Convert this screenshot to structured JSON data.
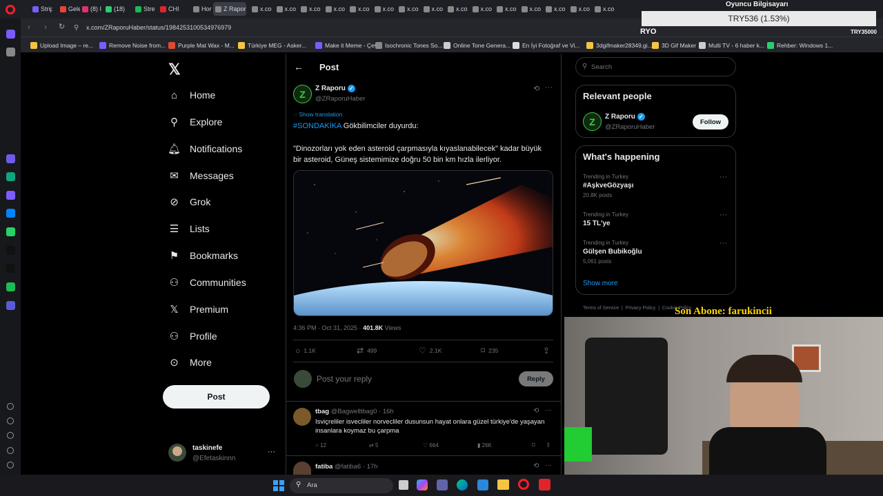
{
  "browser": {
    "tabs": [
      "Strip",
      "Gele",
      "(8) I",
      "(18)",
      "Stre",
      "CHI",
      "Hor",
      "Z Rapor",
      "x.co",
      "x.co",
      "x.co",
      "x.co",
      "x.co",
      "x.co",
      "x.co",
      "x.co",
      "x.co",
      "x.co",
      "x.co",
      "x.co",
      "x.co",
      "x.co",
      "x.co"
    ],
    "url": "x.com/ZRaporuHaber/status/1984253100534976979",
    "bookmarks": [
      "Upload Image – re...",
      "Remove Noise from...",
      "Purple Mat Wax - M...",
      "Türkiye MEG - Asker...",
      "Make it Meme - Çev...",
      "Isochronic Tones So...",
      "Online Tone Genera...",
      "En İyi Fotoğraf ve Vi...",
      "3dgifmaker28349.gi...",
      "3D Gif Maker",
      "Multi TV - 6 haber k...",
      "Rehber: Windows 1..."
    ]
  },
  "overlay": {
    "title": "Oyuncu Bilgisayarı",
    "price": "TRY536 (1.53%)",
    "left_tag": "RYO",
    "right_tag": "TRY35000",
    "subscriber": "Son Abone: farukincii"
  },
  "sidebar": {
    "items": [
      "Home",
      "Explore",
      "Notifications",
      "Messages",
      "Grok",
      "Lists",
      "Bookmarks",
      "Communities",
      "Premium",
      "Profile",
      "More"
    ],
    "post_button": "Post",
    "account": {
      "name": "taskinefe",
      "handle": "@Efetaskinnn"
    }
  },
  "post": {
    "header": "Post",
    "author": "Z Raporu",
    "handle": "@ZRaporuHaber",
    "avatar_letter": "Z",
    "show_translation": "Show translation",
    "hashtag": "#SONDAKİKA",
    "line1_rest": " Gökbilimciler duyurdu:",
    "quote": "\"Dinozorları yok eden asteroid çarpmasıyla kıyaslanabilecek\" kadar büyük bir asteroid, Güneş sistemimize doğru 50 bin km hızla ilerliyor.",
    "timestamp": "4:36 PM · Oct 31, 2025 · ",
    "views_value": "401.8K",
    "views_label": " Views",
    "stats": {
      "replies": "1.1K",
      "reposts": "499",
      "likes": "2.1K",
      "bookmarks": "235"
    },
    "reply_placeholder": "Post your reply",
    "reply_button": "Reply"
  },
  "replies": [
    {
      "name": "tbag",
      "handle": "@Bagwelltbag0 · 16h",
      "text": "Isviçreliler isvecliler norvecliler dusunsun hayat onlara güzel türkiye'de yaşayan insanlara koymaz bu çarpma",
      "replies": "12",
      "reposts": "5",
      "likes": "664",
      "views": "26K"
    },
    {
      "name": "fatiba",
      "handle": "@fatiba6 · 17h"
    }
  ],
  "right": {
    "search_placeholder": "Search",
    "relevant_title": "Relevant people",
    "person_name": "Z Raporu",
    "person_handle": "@ZRaporuHaber",
    "follow": "Follow",
    "happening_title": "What's happening",
    "trends": [
      {
        "context": "Trending in Turkey",
        "name": "#AşkveGözyaşı",
        "posts": "20.8K posts"
      },
      {
        "context": "Trending in Turkey",
        "name": "15 TL'ye",
        "posts": ""
      },
      {
        "context": "Trending in Turkey",
        "name": "Gülşen Bubikoğlu",
        "posts": "5,061 posts"
      }
    ],
    "show_more": "Show more",
    "footer": [
      "Terms of Service",
      "|",
      "Privacy Policy",
      "|",
      "Cookie Policy"
    ]
  },
  "taskbar": {
    "search": "Ara"
  },
  "colors": {
    "accent": "#1d9bf0",
    "bg": "#000000",
    "green": "#39d03b"
  }
}
